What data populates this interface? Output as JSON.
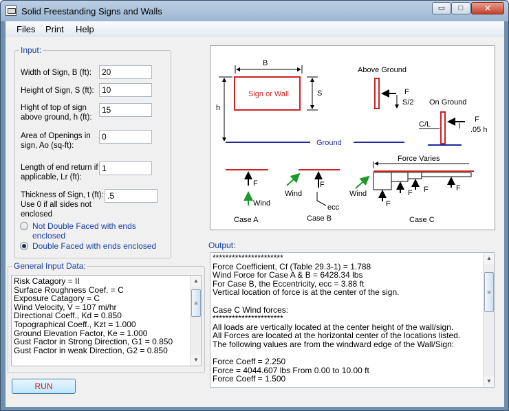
{
  "window": {
    "title": "Solid Freestanding Signs and Walls",
    "min_glyph": "▭",
    "max_glyph": "□",
    "close_glyph": "✕"
  },
  "menu": [
    "Files",
    "Print",
    "Help"
  ],
  "input_group": {
    "title": "Input:",
    "width_label": "Width of Sign, B (ft):",
    "width_value": "20",
    "height_label": "Height of Sign, S (ft):",
    "height_value": "10",
    "top_label_1": "Hight of top of sign",
    "top_label_2": "above ground, h (ft):",
    "top_value": "15",
    "openings_label_1": "Area of Openings in",
    "openings_label_2": "sign, Ao (sq-ft):",
    "openings_value": "0",
    "return_label_1": "Length of end return if",
    "return_label_2": "applicable, Lr (ft):",
    "return_value": "1",
    "thickness_label_1": "Thickness of Sign, t (ft):",
    "thickness_label_2": "Use 0 if all sides not",
    "thickness_label_3": "enclosed",
    "thickness_value": ".5",
    "radio_not_double": "Not Double Faced with ends enclosed",
    "radio_double": "Double Faced with ends enclosed",
    "selected": "double"
  },
  "general": {
    "title": "General Input Data:",
    "lines": [
      "Risk Catagory = II",
      "Surface Roughness Coef. = C",
      "Exposure Catagory = C",
      "Wind Velocity, V = 107 mi/hr",
      "Directional Coeff., Kd = 0.850",
      "Topographical Coeff., Kzt = 1.000",
      "Ground Elevation Factor, Ke = 1.000",
      "Gust Factor in Strong Direction, G1 = 0.850",
      "Gust Factor in weak Direction, G2 = 0.850"
    ]
  },
  "run_label": "RUN",
  "output": {
    "title": "Output:",
    "lines": [
      "**********************",
      "Force Coefficient, Cf (Table 29.3-1) = 1.788",
      "Wind Force for Case A & B = 6428.34 lbs",
      "For Case B, the Eccentricity, ecc = 3.88 ft",
      "Vertical location of force is at the center of the sign.",
      "",
      "Case C Wind forces:",
      "**********************",
      "All loads are vertically located at the center height of the wall/sign.",
      "All Forces are located at the horizontal center of the locations listed.",
      "The following values are from the windward edge of the Wall/Sign:",
      "",
      "Force Coeff = 2.250",
      "Force = 4044.607 lbs From 0.00 to 10.00 ft",
      "Force Coeff = 1.500"
    ]
  },
  "diagram": {
    "B": "B",
    "S": "S",
    "h": "h",
    "sign_label": "Sign or Wall",
    "ground": "Ground",
    "above_ground": "Above Ground",
    "on_ground": "On Ground",
    "F": "F",
    "S2": "S/2",
    "CL": "C/L",
    "h05": ".05 h",
    "wind": "Wind",
    "ecc": "ecc",
    "force_varies": "Force Varies",
    "case_a": "Case A",
    "case_b": "Case B",
    "case_c": "Case C",
    "colors": {
      "sign": "#cc2222",
      "ground": "#1f2a9c",
      "wind_arrow": "#1a9a2a"
    }
  }
}
